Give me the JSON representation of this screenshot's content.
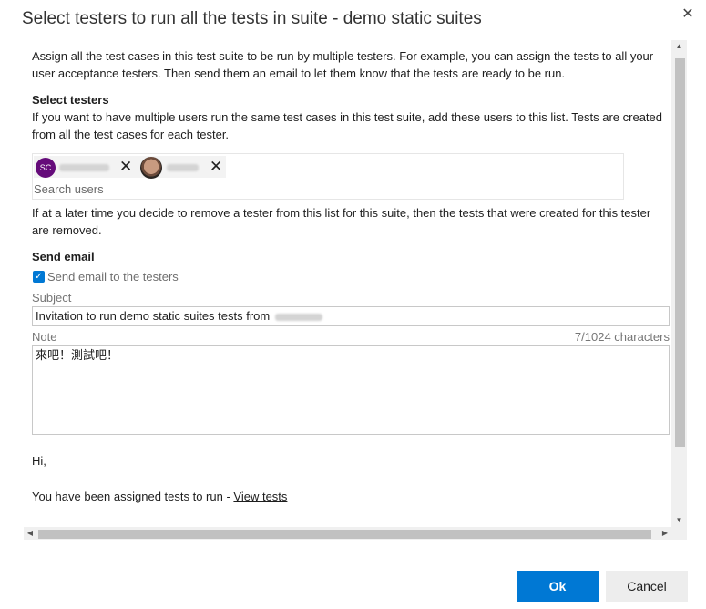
{
  "dialog": {
    "title": "Select testers to run all the tests in suite - demo static suites",
    "close_icon": "✕"
  },
  "intro": "Assign all the test cases in this test suite to be run by multiple testers. For example, you can assign the tests to all your user acceptance testers. Then send them an email to let them know that the tests are ready to be run.",
  "select_testers": {
    "heading": "Select testers",
    "description": "If you want to have multiple users run the same test cases in this test suite, add these users to this list. Tests are created from all the test cases for each tester.",
    "testers": [
      {
        "initials": "SC",
        "avatar_color": "#650b7a",
        "remove_icon": "✕"
      },
      {
        "initials": "",
        "remove_icon": "✕"
      }
    ],
    "search_placeholder": "Search users",
    "remove_note": "If at a later time you decide to remove a tester from this list for this suite, then the tests that were created for this tester are removed."
  },
  "send_email": {
    "heading": "Send email",
    "checkbox_label": "Send email to the testers",
    "checkbox_checked": true,
    "checkbox_icon": "✓",
    "subject_label": "Subject",
    "subject_value": "Invitation to run demo static suites tests from",
    "note_label": "Note",
    "char_count": "7/1024 characters",
    "note_value": "來吧！測試吧！"
  },
  "email_preview": {
    "greeting": "Hi,",
    "body": "You have been assigned tests to run - ",
    "link_text": "View tests"
  },
  "scrollbars": {
    "up_icon": "▲",
    "down_icon": "▼",
    "left_icon": "◀",
    "right_icon": "▶"
  },
  "buttons": {
    "ok": "Ok",
    "cancel": "Cancel"
  },
  "colors": {
    "accent": "#0078d4",
    "avatar_sc": "#650b7a"
  }
}
